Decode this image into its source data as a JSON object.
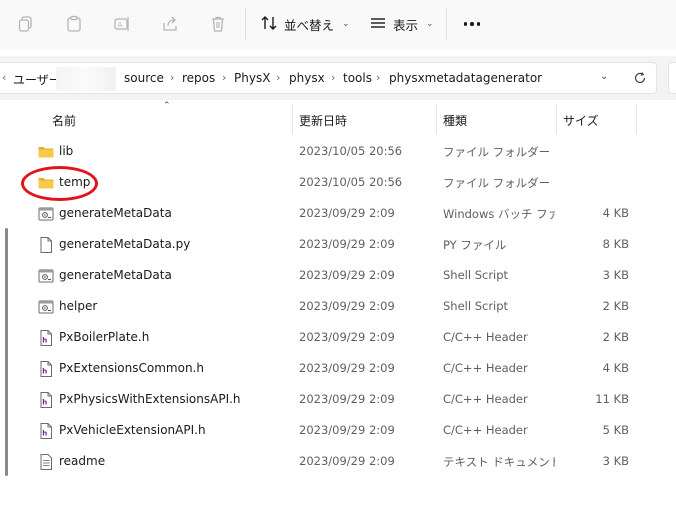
{
  "toolbar": {
    "sort_label": "並べ替え",
    "view_label": "表示",
    "icons": [
      "copy-icon",
      "paste-icon",
      "rename-icon",
      "share-icon",
      "delete-icon",
      "sort-icon",
      "view-icon",
      "more-icon"
    ]
  },
  "address": {
    "breadcrumb": [
      "ユーザー",
      "source",
      "repos",
      "PhysX",
      "physx",
      "tools",
      "physxmetadatagenerator"
    ]
  },
  "columns": {
    "name": "名前",
    "date": "更新日時",
    "type": "種類",
    "size": "サイズ"
  },
  "files": [
    {
      "name": "lib",
      "date": "2023/10/05 20:56",
      "type": "ファイル フォルダー",
      "size": "",
      "icon": "folder-icon"
    },
    {
      "name": "temp",
      "date": "2023/10/05 20:56",
      "type": "ファイル フォルダー",
      "size": "",
      "icon": "folder-icon"
    },
    {
      "name": "generateMetaData",
      "date": "2023/09/29 2:09",
      "type": "Windows バッチ ファイル",
      "size": "4 KB",
      "icon": "batch-file-icon"
    },
    {
      "name": "generateMetaData.py",
      "date": "2023/09/29 2:09",
      "type": "PY ファイル",
      "size": "8 KB",
      "icon": "document-icon"
    },
    {
      "name": "generateMetaData",
      "date": "2023/09/29 2:09",
      "type": "Shell Script",
      "size": "3 KB",
      "icon": "script-file-icon"
    },
    {
      "name": "helper",
      "date": "2023/09/29 2:09",
      "type": "Shell Script",
      "size": "2 KB",
      "icon": "script-file-icon"
    },
    {
      "name": "PxBoilerPlate.h",
      "date": "2023/09/29 2:09",
      "type": "C/C++ Header",
      "size": "2 KB",
      "icon": "header-file-icon"
    },
    {
      "name": "PxExtensionsCommon.h",
      "date": "2023/09/29 2:09",
      "type": "C/C++ Header",
      "size": "4 KB",
      "icon": "header-file-icon"
    },
    {
      "name": "PxPhysicsWithExtensionsAPI.h",
      "date": "2023/09/29 2:09",
      "type": "C/C++ Header",
      "size": "11 KB",
      "icon": "header-file-icon"
    },
    {
      "name": "PxVehicleExtensionAPI.h",
      "date": "2023/09/29 2:09",
      "type": "C/C++ Header",
      "size": "5 KB",
      "icon": "header-file-icon"
    },
    {
      "name": "readme",
      "date": "2023/09/29 2:09",
      "type": "テキスト ドキュメント",
      "size": "3 KB",
      "icon": "text-file-icon"
    }
  ],
  "colors": {
    "folder": "#f5c342",
    "annotation": "#e0141c",
    "secondary_text": "#5f5f5f"
  }
}
